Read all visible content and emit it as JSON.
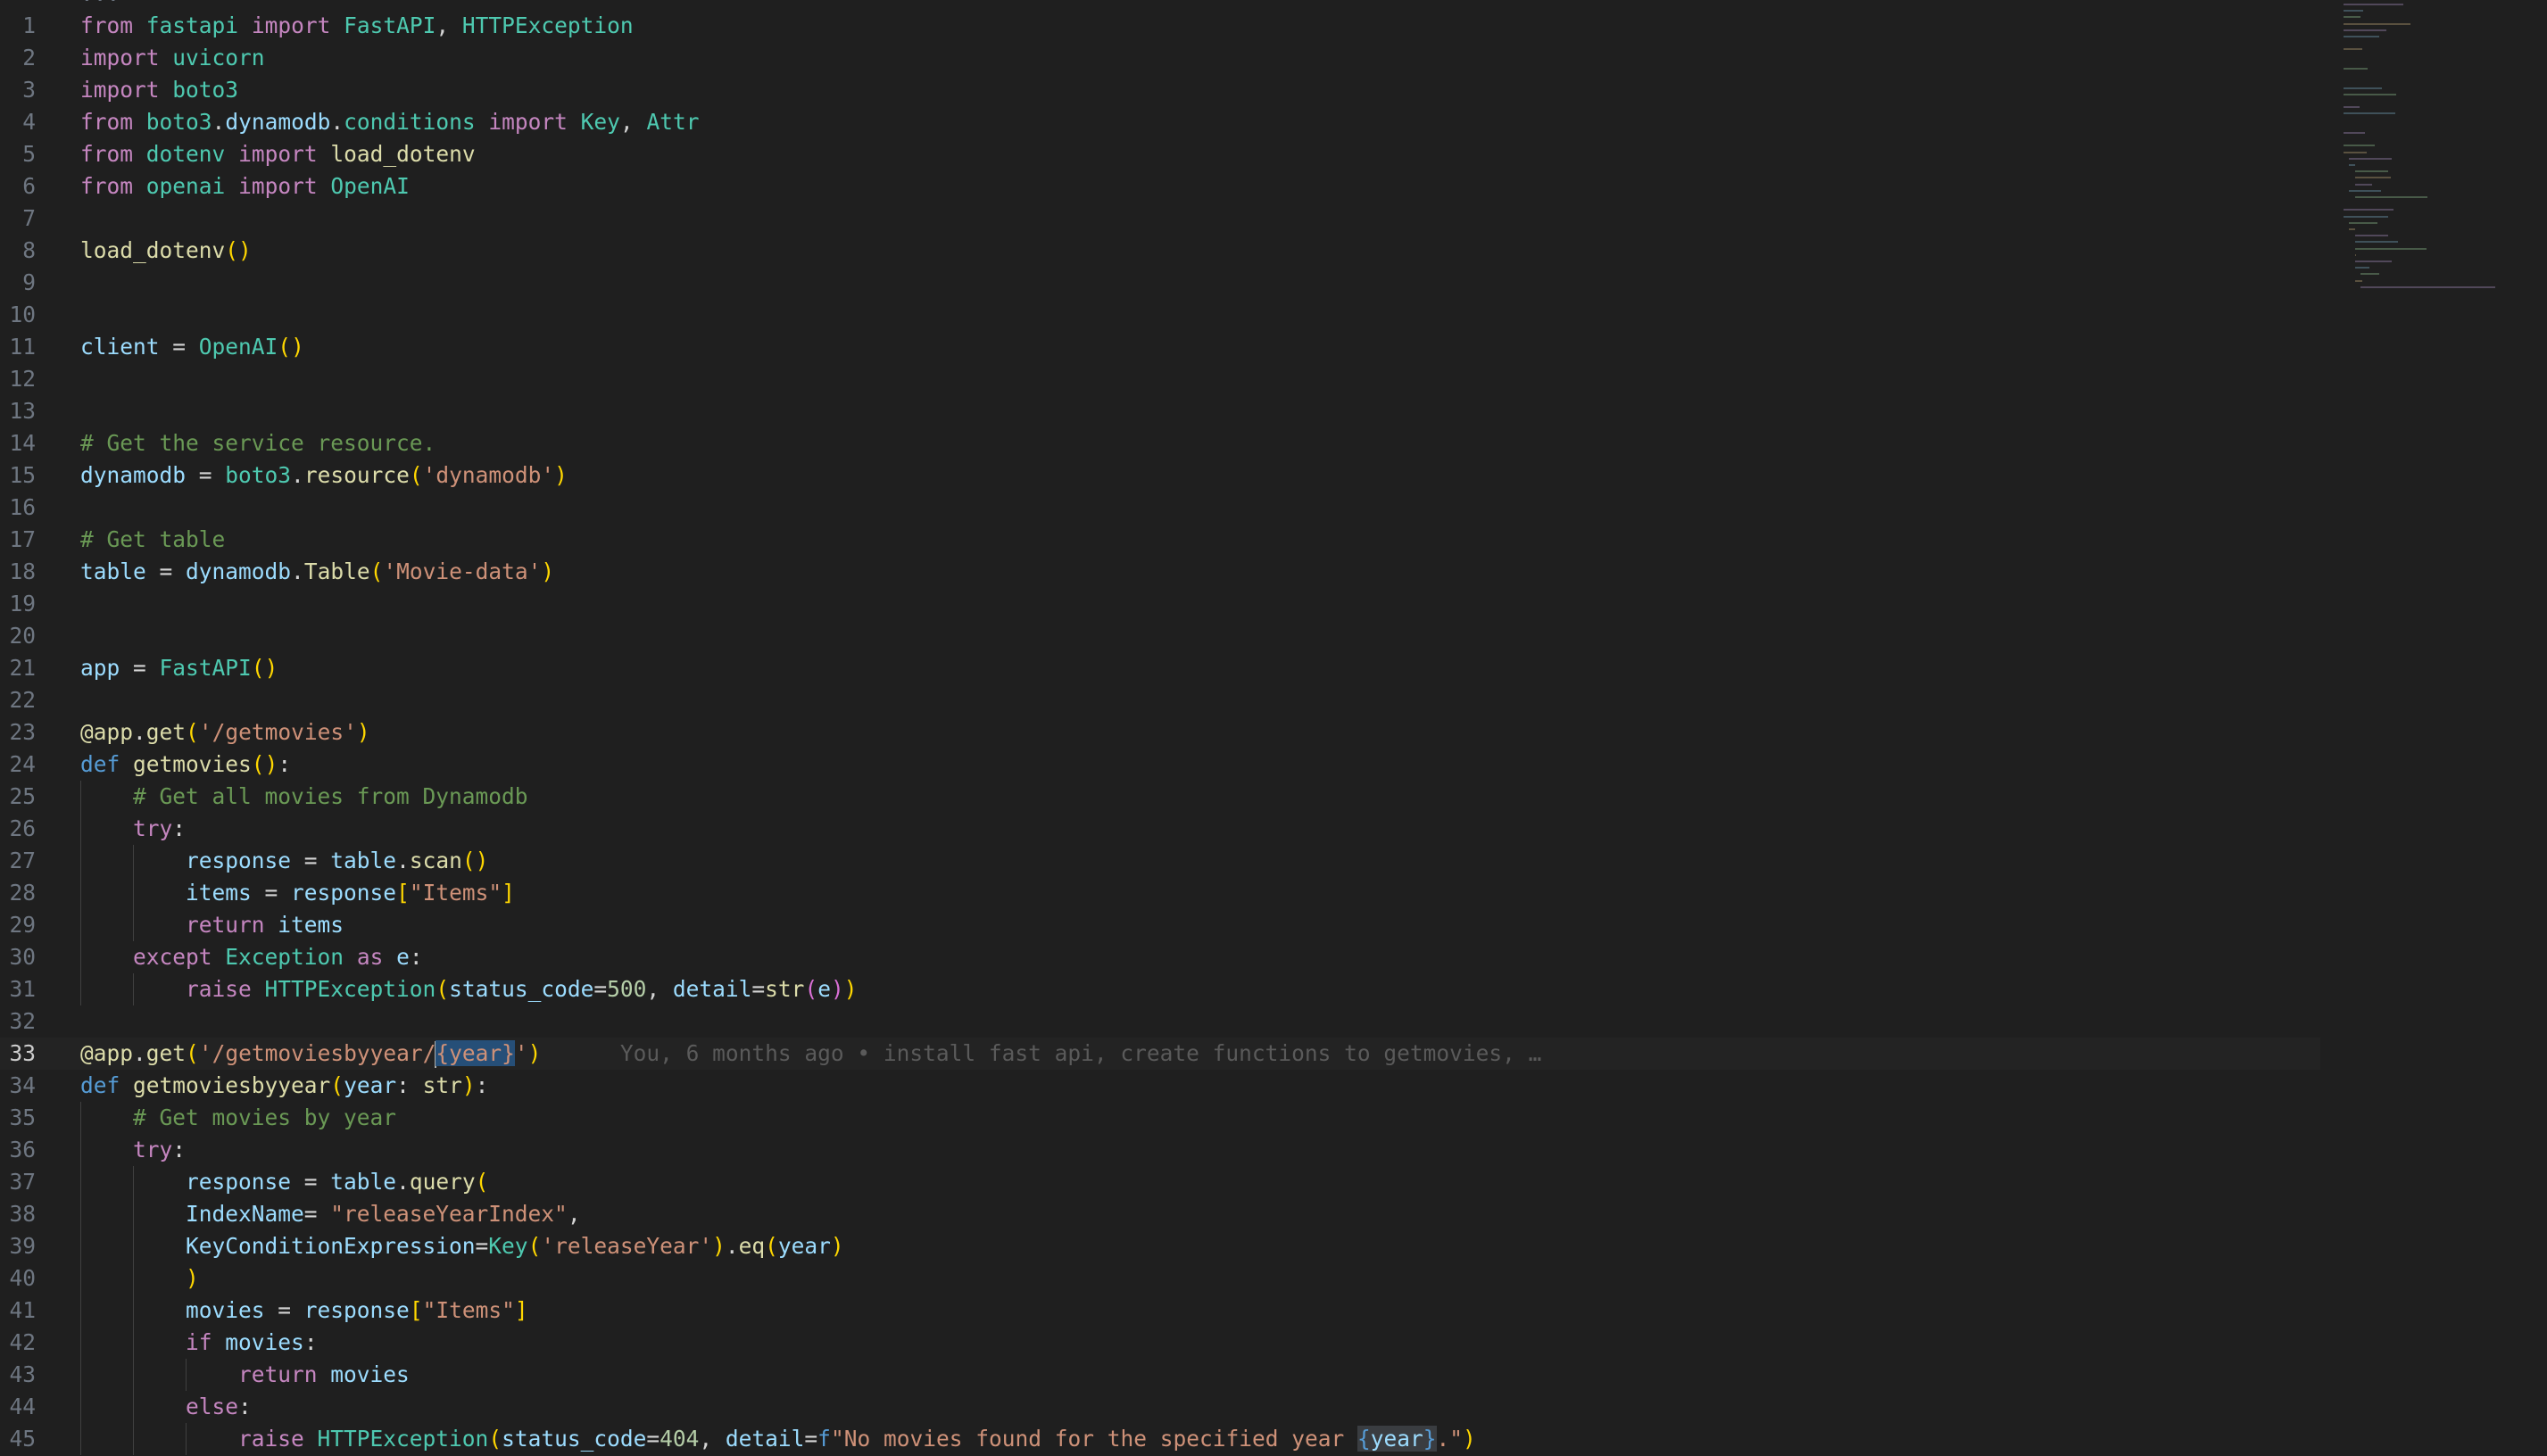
{
  "editor": {
    "breadcrumb_fragment": "...",
    "blame": "You, 6 months ago • install fast api, create functions to getmovies, …",
    "lines": [
      {
        "n": "1",
        "t": "from fastapi import FastAPI, HTTPException"
      },
      {
        "n": "2",
        "t": "import uvicorn"
      },
      {
        "n": "3",
        "t": "import boto3"
      },
      {
        "n": "4",
        "t": "from boto3.dynamodb.conditions import Key, Attr"
      },
      {
        "n": "5",
        "t": "from dotenv import load_dotenv"
      },
      {
        "n": "6",
        "t": "from openai import OpenAI"
      },
      {
        "n": "7",
        "t": ""
      },
      {
        "n": "8",
        "t": "load_dotenv()"
      },
      {
        "n": "9",
        "t": ""
      },
      {
        "n": "10",
        "t": ""
      },
      {
        "n": "11",
        "t": "client = OpenAI()"
      },
      {
        "n": "12",
        "t": ""
      },
      {
        "n": "13",
        "t": ""
      },
      {
        "n": "14",
        "t": "# Get the service resource."
      },
      {
        "n": "15",
        "t": "dynamodb = boto3.resource('dynamodb')"
      },
      {
        "n": "16",
        "t": ""
      },
      {
        "n": "17",
        "t": "# Get table"
      },
      {
        "n": "18",
        "t": "table = dynamodb.Table('Movie-data')"
      },
      {
        "n": "19",
        "t": ""
      },
      {
        "n": "20",
        "t": ""
      },
      {
        "n": "21",
        "t": "app = FastAPI()"
      },
      {
        "n": "22",
        "t": ""
      },
      {
        "n": "23",
        "t": "@app.get('/getmovies')"
      },
      {
        "n": "24",
        "t": "def getmovies():"
      },
      {
        "n": "25",
        "t": "    # Get all movies from Dynamodb"
      },
      {
        "n": "26",
        "t": "    try:"
      },
      {
        "n": "27",
        "t": "        response = table.scan()"
      },
      {
        "n": "28",
        "t": "        items = response[\"Items\"]"
      },
      {
        "n": "29",
        "t": "        return items"
      },
      {
        "n": "30",
        "t": "    except Exception as e:"
      },
      {
        "n": "31",
        "t": "        raise HTTPException(status_code=500, detail=str(e))"
      },
      {
        "n": "32",
        "t": ""
      },
      {
        "n": "33",
        "t": "@app.get('/getmoviesbyyear/{year}')"
      },
      {
        "n": "34",
        "t": "def getmoviesbyyear(year: str):"
      },
      {
        "n": "35",
        "t": "    # Get movies by year"
      },
      {
        "n": "36",
        "t": "    try:"
      },
      {
        "n": "37",
        "t": "        response = table.query("
      },
      {
        "n": "38",
        "t": "        IndexName= \"releaseYearIndex\","
      },
      {
        "n": "39",
        "t": "        KeyConditionExpression=Key('releaseYear').eq(year)"
      },
      {
        "n": "40",
        "t": "        )"
      },
      {
        "n": "41",
        "t": "        movies = response[\"Items\"]"
      },
      {
        "n": "42",
        "t": "        if movies:"
      },
      {
        "n": "43",
        "t": "            return movies"
      },
      {
        "n": "44",
        "t": "        else:"
      },
      {
        "n": "45",
        "t": "            raise HTTPException(status_code=404, detail=f\"No movies found for the specified year {year}.\")"
      }
    ]
  },
  "colors": {
    "background": "#1f1f1f",
    "keyword": "#c586c0",
    "string": "#ce9178",
    "comment": "#6a9955",
    "function": "#dcdcaa",
    "class": "#4ec9b0",
    "variable": "#9cdcfe",
    "selection": "#264f78"
  }
}
